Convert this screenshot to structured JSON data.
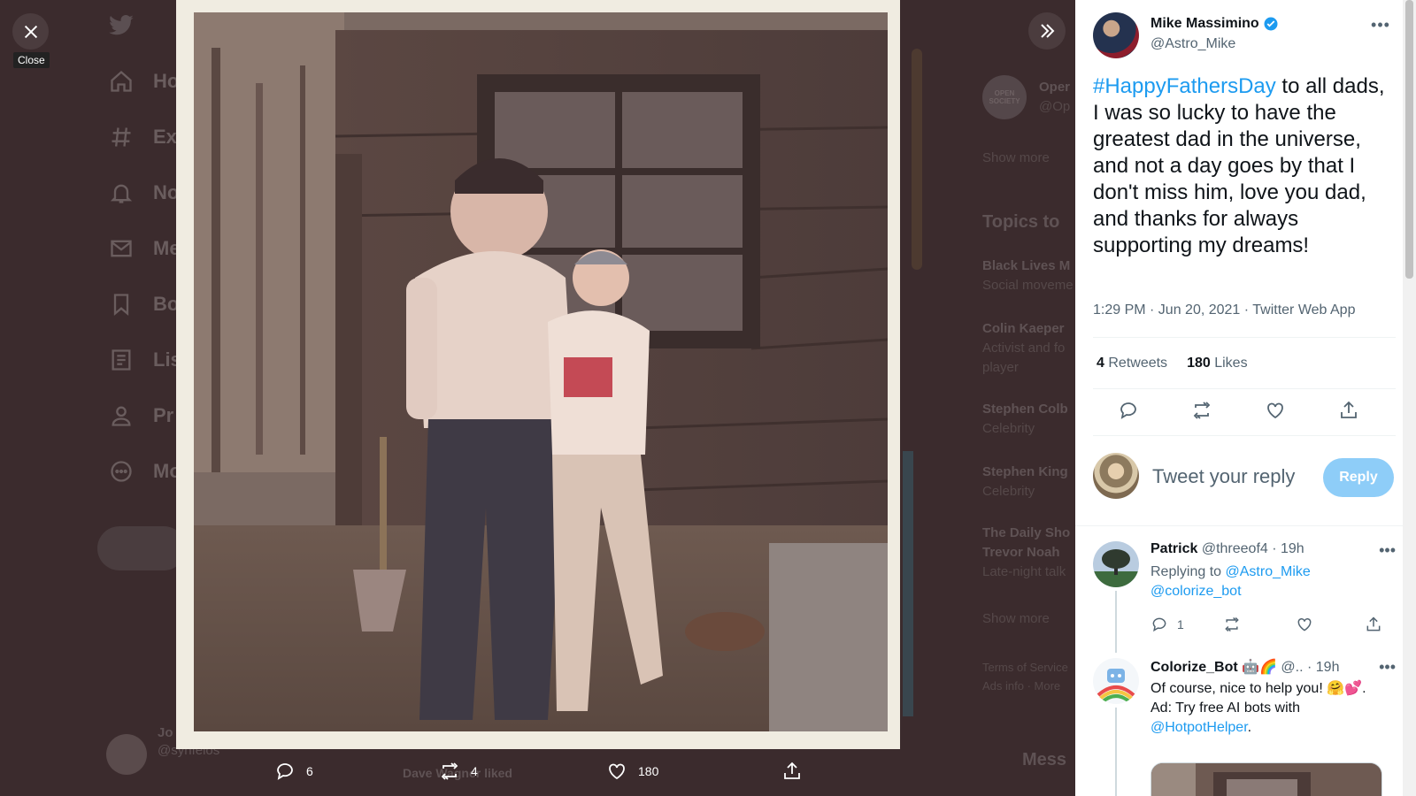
{
  "close": {
    "tooltip": "Close"
  },
  "background": {
    "nav": [
      {
        "label": "Ho",
        "icon": "home-icon"
      },
      {
        "label": "Ex",
        "icon": "hashtag-icon"
      },
      {
        "label": "No",
        "icon": "bell-icon"
      },
      {
        "label": "Me",
        "icon": "mail-icon"
      },
      {
        "label": "Bo",
        "icon": "bookmark-icon"
      },
      {
        "label": "Lis",
        "icon": "list-icon"
      },
      {
        "label": "Pr",
        "icon": "person-icon"
      },
      {
        "label": "Mo",
        "icon": "more-circle-icon"
      }
    ],
    "right": {
      "org_avatar": "OPEN SOCIETY",
      "org_name": "Oper",
      "org_handle": "@Op",
      "show_more_1": "Show more",
      "topics_heading": "Topics to",
      "topics": [
        {
          "name": "Black Lives M",
          "sub": "Social moveme"
        },
        {
          "name": "Colin Kaeper",
          "sub": "Activist and fo"
        },
        {
          "name": "player",
          "sub": ""
        },
        {
          "name": "Stephen Colb",
          "sub": "Celebrity"
        },
        {
          "name": "Stephen King",
          "sub": "Celebrity"
        },
        {
          "name": "The Daily Sho",
          "sub": "Trevor Noah"
        },
        {
          "name": "Late-night talk",
          "sub": ""
        }
      ],
      "show_more_2": "Show more",
      "footer_1": "Terms of Service",
      "footer_2": "Ads info · More",
      "messages": "Mess"
    },
    "bottom": {
      "name": "Jo",
      "handle": "@synfelos",
      "liked": "Dave Wagner liked",
      "dots": "..."
    }
  },
  "photo_actions": {
    "replies": "6",
    "retweets": "4",
    "likes": "180"
  },
  "tweet": {
    "author_name": "Mike Massimino",
    "author_handle": "@Astro_Mike",
    "hashtag": "#HappyFathersDay",
    "text": " to all dads, I was so lucky to have the greatest dad in the universe, and not a day goes by that I don't miss him, love you dad, and thanks for always supporting my dreams!",
    "meta": "1:29 PM · Jun 20, 2021 · Twitter Web App",
    "retweets_count": "4",
    "retweets_label": "Retweets",
    "likes_count": "180",
    "likes_label": "Likes"
  },
  "reply_box": {
    "placeholder": "Tweet your reply",
    "button": "Reply"
  },
  "replies": [
    {
      "name": "Patrick",
      "handle": "@threeof4",
      "time": "19h",
      "replying_prefix": "Replying to ",
      "replying_to_1": "@Astro_Mike",
      "replying_to_2": "@colorize_bot",
      "reply_count": "1"
    },
    {
      "name": "Colorize_Bot",
      "emoji": "🤖🌈",
      "handle": "@..",
      "time": "19h",
      "text_1": "Of course, nice to help you! 🤗💕.",
      "text_2": "Ad: Try free AI bots with",
      "link": "@HotpotHelper",
      "text_3": "."
    }
  ],
  "colors": {
    "accent": "#1d9bf0",
    "reply_button": "#8ecdf8",
    "overlay": "#3b2b2d"
  }
}
